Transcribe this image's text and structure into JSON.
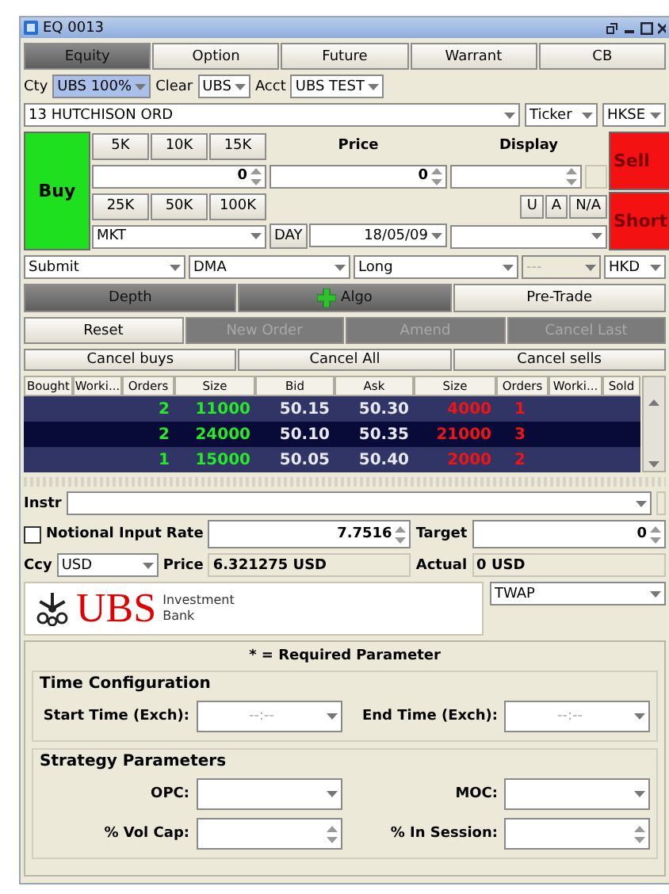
{
  "window": {
    "title": "EQ 0013"
  },
  "tabs": [
    {
      "label": "Equity",
      "selected": true
    },
    {
      "label": "Option",
      "selected": false
    },
    {
      "label": "Future",
      "selected": false
    },
    {
      "label": "Warrant",
      "selected": false
    },
    {
      "label": "CB",
      "selected": false
    }
  ],
  "account_row": [
    {
      "label": "Cty",
      "value": "UBS 100%",
      "highlighted": true
    },
    {
      "label": "Clear",
      "value": "UBS",
      "highlighted": false
    },
    {
      "label": "Acct",
      "value": "UBS TEST",
      "highlighted": false
    }
  ],
  "instrument": {
    "value": "13 HUTCHISON ORD",
    "id_type": "Ticker",
    "exchange": "HKSE"
  },
  "ticket": {
    "buy": "Buy",
    "sell": "Sell",
    "short": "Short",
    "presets_top": [
      "5K",
      "10K",
      "15K"
    ],
    "presets_bottom": [
      "25K",
      "50K",
      "100K"
    ],
    "quantity": "0",
    "price_label": "Price",
    "price": "0",
    "display_label": "Display",
    "flags": [
      "U",
      "A",
      "N/A"
    ],
    "order_type": "MKT",
    "tif": "DAY",
    "date": "18/05/09"
  },
  "routing": [
    {
      "value": "Submit",
      "disabled": false
    },
    {
      "value": "DMA",
      "disabled": false
    },
    {
      "value": "Long",
      "disabled": false
    },
    {
      "value": "---",
      "disabled": true
    },
    {
      "value": "HKD",
      "disabled": false
    }
  ],
  "panel_buttons": [
    {
      "label": "Depth",
      "selected": true,
      "kind": "text"
    },
    {
      "label": "Algo",
      "selected": true,
      "kind": "add"
    },
    {
      "label": "Pre-Trade",
      "selected": false,
      "kind": "text"
    }
  ],
  "actions": [
    {
      "label": "Reset",
      "disabled": false
    },
    {
      "label": "New Order",
      "disabled": true
    },
    {
      "label": "Amend",
      "disabled": true
    },
    {
      "label": "Cancel Last",
      "disabled": true
    }
  ],
  "cancel_buttons": [
    "Cancel buys",
    "Cancel All",
    "Cancel sells"
  ],
  "depth": {
    "columns": [
      "Bought",
      "Worki...",
      "Orders",
      "Size",
      "Bid",
      "Ask",
      "Size",
      "Orders",
      "Worki...",
      "Sold"
    ],
    "rows": [
      {
        "bid_orders": "2",
        "bid_size": "11000",
        "bid": "50.15",
        "ask": "50.30",
        "ask_size": "4000",
        "ask_orders": "1"
      },
      {
        "bid_orders": "2",
        "bid_size": "24000",
        "bid": "50.10",
        "ask": "50.35",
        "ask_size": "21000",
        "ask_orders": "3"
      },
      {
        "bid_orders": "1",
        "bid_size": "15000",
        "bid": "50.05",
        "ask": "50.40",
        "ask_size": "2000",
        "ask_orders": "2"
      }
    ]
  },
  "algo": {
    "instr_label": "Instr",
    "notional": {
      "label": "Notional Input",
      "checked": false
    },
    "rate_label": "Rate",
    "rate": "7.7516",
    "target_label": "Target",
    "target": "0",
    "ccy_label": "Ccy",
    "ccy": "USD",
    "price_label": "Price",
    "price": "6.321275 USD",
    "actual_label": "Actual",
    "actual": "0 USD",
    "logo": {
      "name": "UBS",
      "lines": [
        "Investment",
        "Bank"
      ]
    },
    "strategy": "TWAP",
    "required_note": "* = Required Parameter",
    "groups": [
      {
        "title": "Time Configuration",
        "fields": [
          {
            "label": "Start Time (Exch):",
            "kind": "time",
            "value": "--:--"
          },
          {
            "label": "End Time (Exch):",
            "kind": "time",
            "value": "--:--"
          }
        ]
      },
      {
        "title": "Strategy Parameters",
        "fields": [
          {
            "label": "OPC:",
            "kind": "select"
          },
          {
            "label": "MOC:",
            "kind": "select"
          },
          {
            "label": "% Vol Cap:",
            "kind": "spin"
          },
          {
            "label": "% In Session:",
            "kind": "spin"
          }
        ]
      }
    ]
  }
}
